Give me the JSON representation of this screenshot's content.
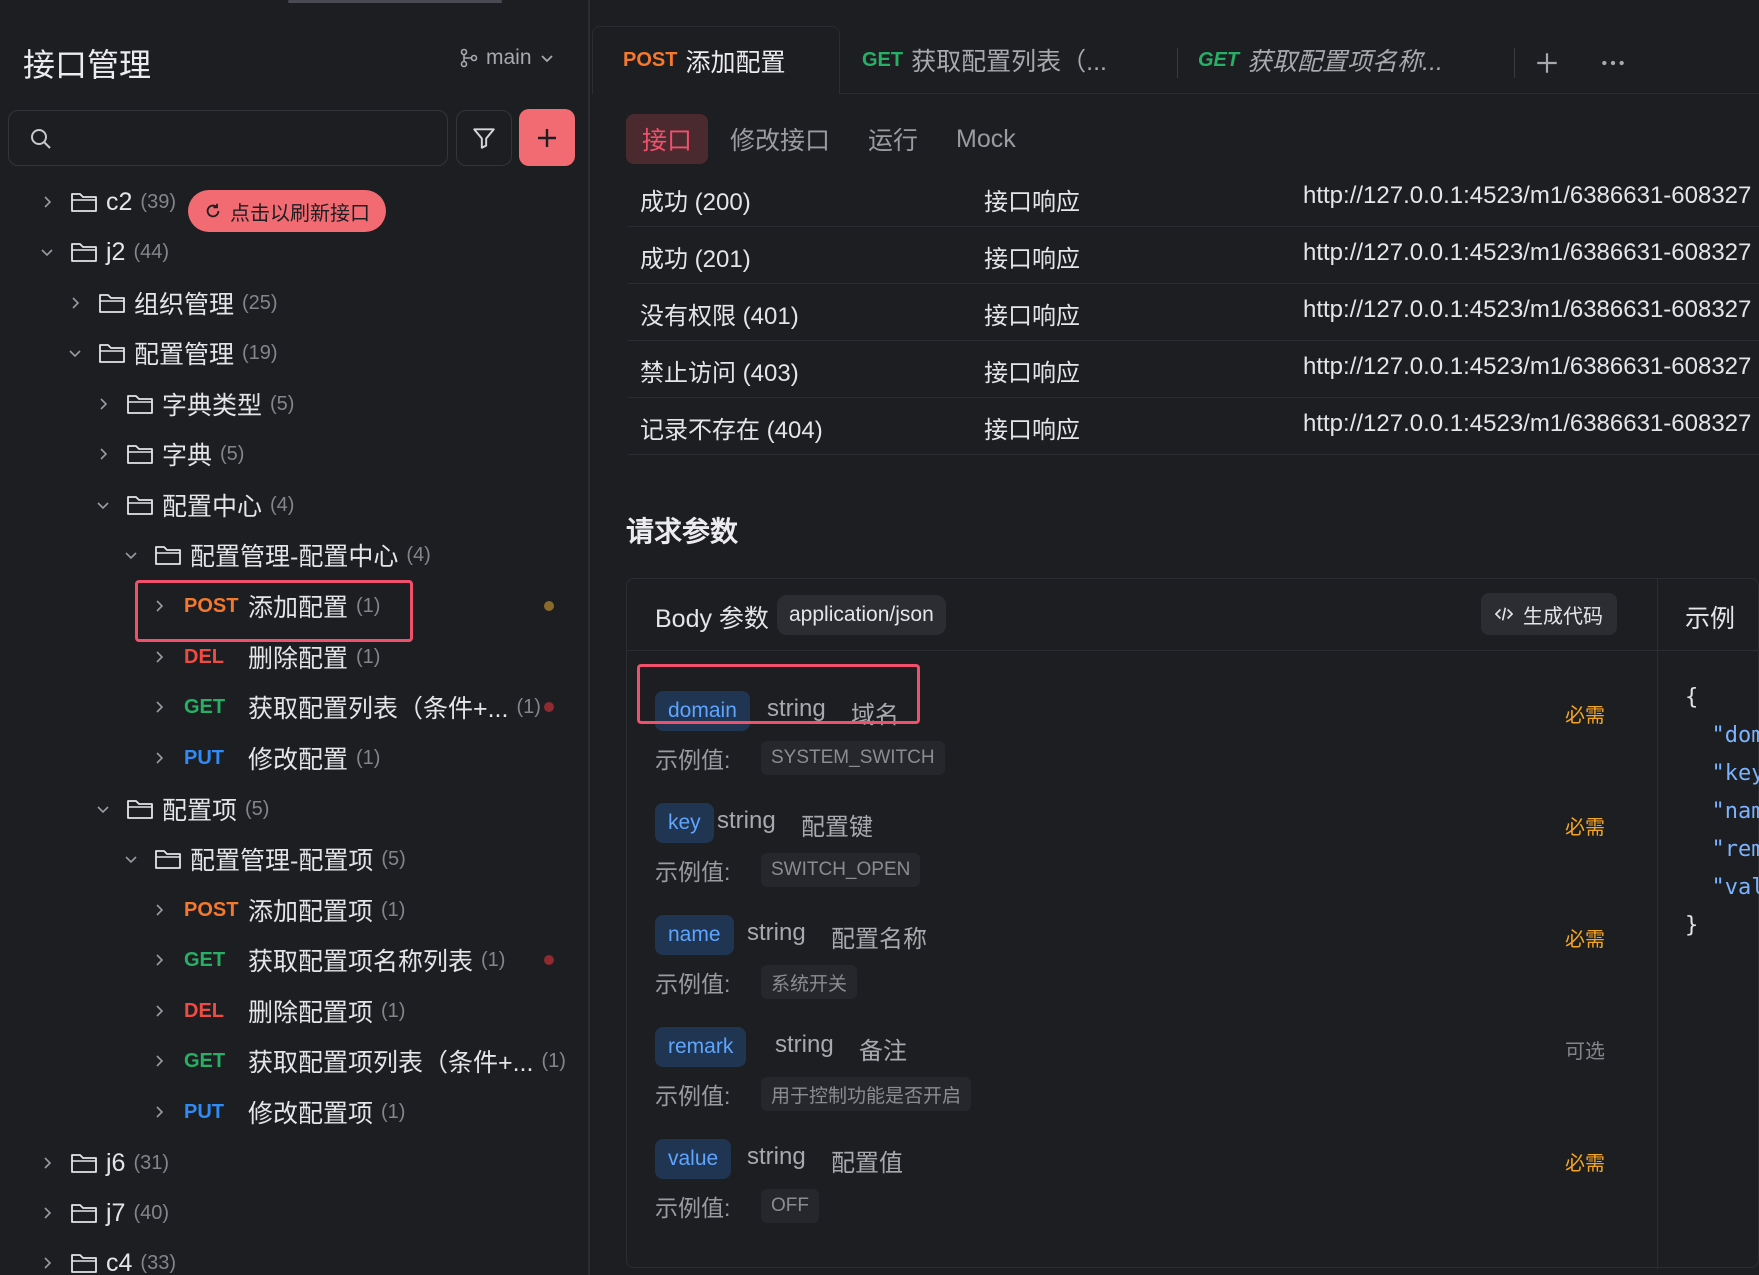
{
  "sidebar": {
    "title": "接口管理",
    "branch": "main",
    "refresh_pill": "点击以刷新接口",
    "tree": [
      {
        "kind": "folder",
        "name": "c2",
        "count": "(39)",
        "expanded": false
      },
      {
        "kind": "folder",
        "name": "j2",
        "count": "(44)",
        "expanded": true
      },
      {
        "kind": "folder",
        "name": "组织管理",
        "count": "(25)",
        "expanded": false
      },
      {
        "kind": "folder",
        "name": "配置管理",
        "count": "(19)",
        "expanded": true
      },
      {
        "kind": "folder",
        "name": "字典类型",
        "count": "(5)",
        "expanded": false
      },
      {
        "kind": "folder",
        "name": "字典",
        "count": "(5)",
        "expanded": false
      },
      {
        "kind": "folder",
        "name": "配置中心",
        "count": "(4)",
        "expanded": true
      },
      {
        "kind": "folder",
        "name": "配置管理-配置中心",
        "count": "(4)",
        "expanded": true
      },
      {
        "kind": "endpoint",
        "method": "POST",
        "name": "添加配置",
        "count": "(1)",
        "selected": true
      },
      {
        "kind": "endpoint",
        "method": "DEL",
        "name": "删除配置",
        "count": "(1)"
      },
      {
        "kind": "endpoint",
        "method": "GET",
        "name": "获取配置列表（条件+...",
        "count": "(1)"
      },
      {
        "kind": "endpoint",
        "method": "PUT",
        "name": "修改配置",
        "count": "(1)"
      },
      {
        "kind": "folder",
        "name": "配置项",
        "count": "(5)",
        "expanded": true
      },
      {
        "kind": "folder",
        "name": "配置管理-配置项",
        "count": "(5)",
        "expanded": true
      },
      {
        "kind": "endpoint",
        "method": "POST",
        "name": "添加配置项",
        "count": "(1)"
      },
      {
        "kind": "endpoint",
        "method": "GET",
        "name": "获取配置项名称列表",
        "count": "(1)"
      },
      {
        "kind": "endpoint",
        "method": "DEL",
        "name": "删除配置项",
        "count": "(1)"
      },
      {
        "kind": "endpoint",
        "method": "GET",
        "name": "获取配置项列表（条件+...",
        "count": "(1)"
      },
      {
        "kind": "endpoint",
        "method": "PUT",
        "name": "修改配置项",
        "count": "(1)"
      },
      {
        "kind": "folder",
        "name": "j6",
        "count": "(31)",
        "expanded": false
      },
      {
        "kind": "folder",
        "name": "j7",
        "count": "(40)",
        "expanded": false
      },
      {
        "kind": "folder",
        "name": "c4",
        "count": "(33)",
        "expanded": false
      }
    ]
  },
  "tabs": [
    {
      "method": "POST",
      "label": "添加配置",
      "active": true
    },
    {
      "method": "GET",
      "label": "获取配置列表（...",
      "active": false
    },
    {
      "method": "GET",
      "label": "获取配置项名称...",
      "active": false,
      "italic": true
    }
  ],
  "subtabs": [
    "接口",
    "修改接口",
    "运行",
    "Mock"
  ],
  "responses": [
    {
      "name": "成功 (200)",
      "type": "接口响应",
      "url": "http://127.0.0.1:4523/m1/6386631-608327"
    },
    {
      "name": "成功 (201)",
      "type": "接口响应",
      "url": "http://127.0.0.1:4523/m1/6386631-608327"
    },
    {
      "name": "没有权限 (401)",
      "type": "接口响应",
      "url": "http://127.0.0.1:4523/m1/6386631-608327"
    },
    {
      "name": "禁止访问 (403)",
      "type": "接口响应",
      "url": "http://127.0.0.1:4523/m1/6386631-608327"
    },
    {
      "name": "记录不存在 (404)",
      "type": "接口响应",
      "url": "http://127.0.0.1:4523/m1/6386631-608327"
    }
  ],
  "request_params_title": "请求参数",
  "body": {
    "label": "Body 参数",
    "content_type": "application/json",
    "gen_code": "生成代码",
    "example_label": "示例",
    "example_value_label": "示例值:",
    "params": [
      {
        "name": "domain",
        "type": "string",
        "desc": "域名",
        "required": "必需",
        "example": "SYSTEM_SWITCH"
      },
      {
        "name": "key",
        "type": "string",
        "desc": "配置键",
        "required": "必需",
        "example": "SWITCH_OPEN"
      },
      {
        "name": "name",
        "type": "string",
        "desc": "配置名称",
        "required": "必需",
        "example": "系统开关"
      },
      {
        "name": "remark",
        "type": "string",
        "desc": "备注",
        "required": "可选",
        "example": "用于控制功能是否开启"
      },
      {
        "name": "value",
        "type": "string",
        "desc": "配置值",
        "required": "必需",
        "example": "OFF"
      }
    ],
    "code_lines": [
      "{",
      "  \"dom",
      "  \"key",
      "  \"nam",
      "  \"rem",
      "  \"val",
      "}"
    ]
  },
  "colors": {
    "accent": "#f26b72",
    "post": "#f5782f",
    "get": "#27b065",
    "del": "#ef4b43",
    "put": "#2f8bf5",
    "required": "#f5a623",
    "optional": "#84858b",
    "highlight_box": "#f0506c"
  }
}
